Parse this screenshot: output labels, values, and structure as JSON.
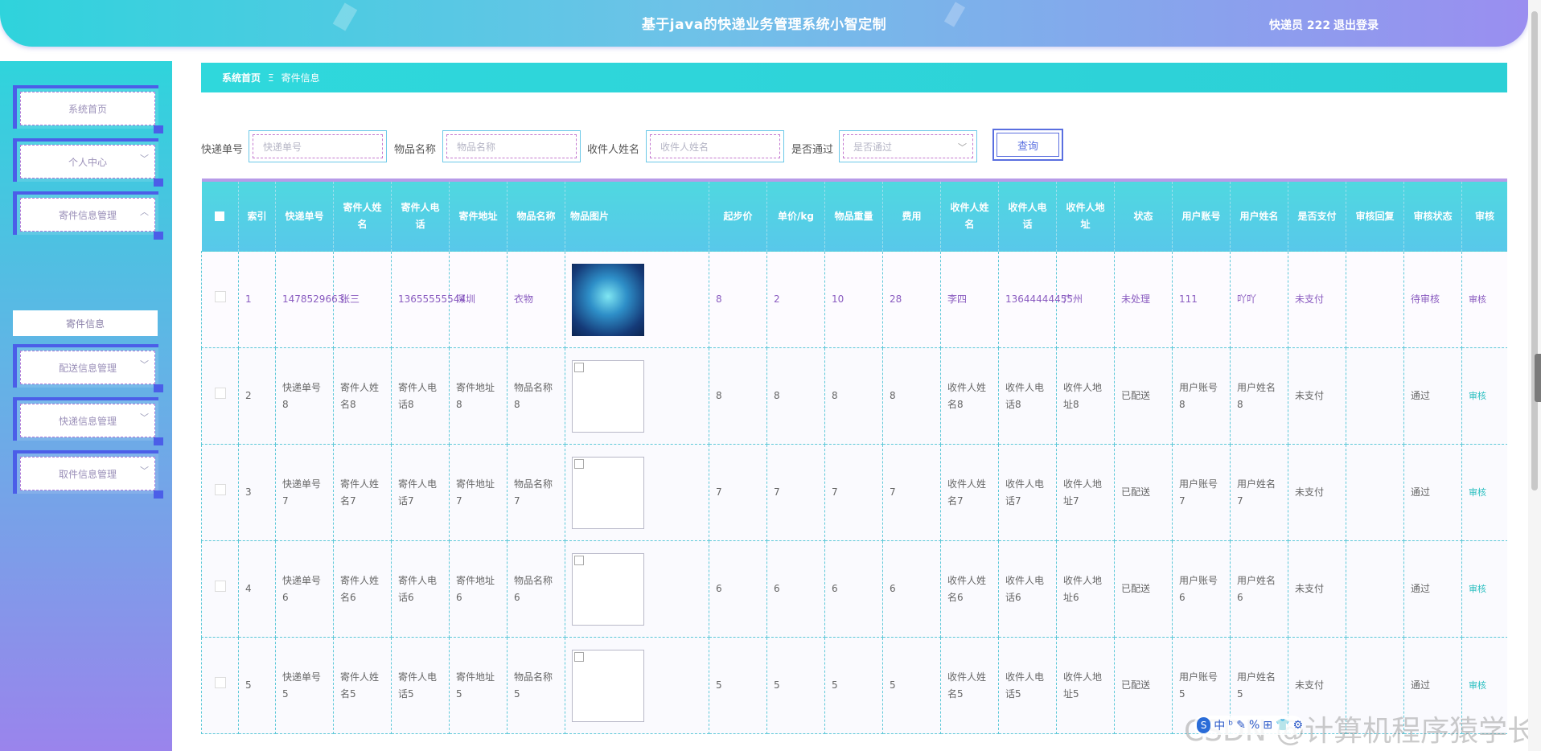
{
  "header": {
    "title": "基于java的快递业务管理系统小智定制",
    "user_label": "快递员 222",
    "logout_label": "退出登录"
  },
  "sidebar": {
    "items": [
      {
        "label": "系统首页"
      },
      {
        "label": "个人中心"
      },
      {
        "label": "寄件信息管理"
      },
      {
        "label": "配送信息管理"
      },
      {
        "label": "快递信息管理"
      },
      {
        "label": "取件信息管理"
      }
    ],
    "submenu_label": "寄件信息"
  },
  "breadcrumb": {
    "home": "系统首页",
    "separator": "Ξ",
    "current": "寄件信息"
  },
  "search": {
    "fields": [
      {
        "label": "快递单号",
        "placeholder": "快递单号"
      },
      {
        "label": "物品名称",
        "placeholder": "物品名称"
      },
      {
        "label": "收件人姓名",
        "placeholder": "收件人姓名"
      },
      {
        "label": "是否通过",
        "placeholder": "是否通过"
      }
    ],
    "button_label": "查询"
  },
  "table": {
    "headers": [
      "索引",
      "快递单号",
      "寄件人姓名",
      "寄件人电话",
      "寄件地址",
      "物品名称",
      "物品图片",
      "起步价",
      "单价/kg",
      "物品重量",
      "费用",
      "收件人姓名",
      "收件人电话",
      "收件人地址",
      "状态",
      "用户账号",
      "用户姓名",
      "是否支付",
      "审核回复",
      "审核状态",
      "审核"
    ],
    "rows": [
      {
        "idx": "1",
        "no": "1478529663",
        "sender": "张三",
        "sphone": "13655555544",
        "saddr": "深圳",
        "item": "衣物",
        "start": "8",
        "unit": "2",
        "weight": "10",
        "fee": "28",
        "recv": "李四",
        "rphone": "13644444455",
        "raddr": "广州",
        "status": "未处理",
        "account": "111",
        "uname": "吖吖",
        "paid": "未支付",
        "reply": "",
        "audit": "待审核",
        "action": "审核"
      },
      {
        "idx": "2",
        "no": "快递单号8",
        "sender": "寄件人姓名8",
        "sphone": "寄件人电话8",
        "saddr": "寄件地址8",
        "item": "物品名称8",
        "start": "8",
        "unit": "8",
        "weight": "8",
        "fee": "8",
        "recv": "收件人姓名8",
        "rphone": "收件人电话8",
        "raddr": "收件人地址8",
        "status": "已配送",
        "account": "用户账号8",
        "uname": "用户姓名8",
        "paid": "未支付",
        "reply": "",
        "audit": "通过",
        "action": "审核"
      },
      {
        "idx": "3",
        "no": "快递单号7",
        "sender": "寄件人姓名7",
        "sphone": "寄件人电话7",
        "saddr": "寄件地址7",
        "item": "物品名称7",
        "start": "7",
        "unit": "7",
        "weight": "7",
        "fee": "7",
        "recv": "收件人姓名7",
        "rphone": "收件人电话7",
        "raddr": "收件人地址7",
        "status": "已配送",
        "account": "用户账号7",
        "uname": "用户姓名7",
        "paid": "未支付",
        "reply": "",
        "audit": "通过",
        "action": "审核"
      },
      {
        "idx": "4",
        "no": "快递单号6",
        "sender": "寄件人姓名6",
        "sphone": "寄件人电话6",
        "saddr": "寄件地址6",
        "item": "物品名称6",
        "start": "6",
        "unit": "6",
        "weight": "6",
        "fee": "6",
        "recv": "收件人姓名6",
        "rphone": "收件人电话6",
        "raddr": "收件人地址6",
        "status": "已配送",
        "account": "用户账号6",
        "uname": "用户姓名6",
        "paid": "未支付",
        "reply": "",
        "audit": "通过",
        "action": "审核"
      },
      {
        "idx": "5",
        "no": "快递单号5",
        "sender": "寄件人姓名5",
        "sphone": "寄件人电话5",
        "saddr": "寄件地址5",
        "item": "物品名称5",
        "start": "5",
        "unit": "5",
        "weight": "5",
        "fee": "5",
        "recv": "收件人姓名5",
        "rphone": "收件人电话5",
        "raddr": "收件人地址5",
        "status": "已配送",
        "account": "用户账号5",
        "uname": "用户姓名5",
        "paid": "未支付",
        "reply": "",
        "audit": "通过",
        "action": "审核"
      }
    ]
  },
  "watermark": {
    "text": "CSDN @计算机程序猿学长",
    "ime_labels": [
      "中",
      "ᵇ",
      "✎",
      "%",
      "⊞",
      "👕",
      "⚙"
    ]
  }
}
